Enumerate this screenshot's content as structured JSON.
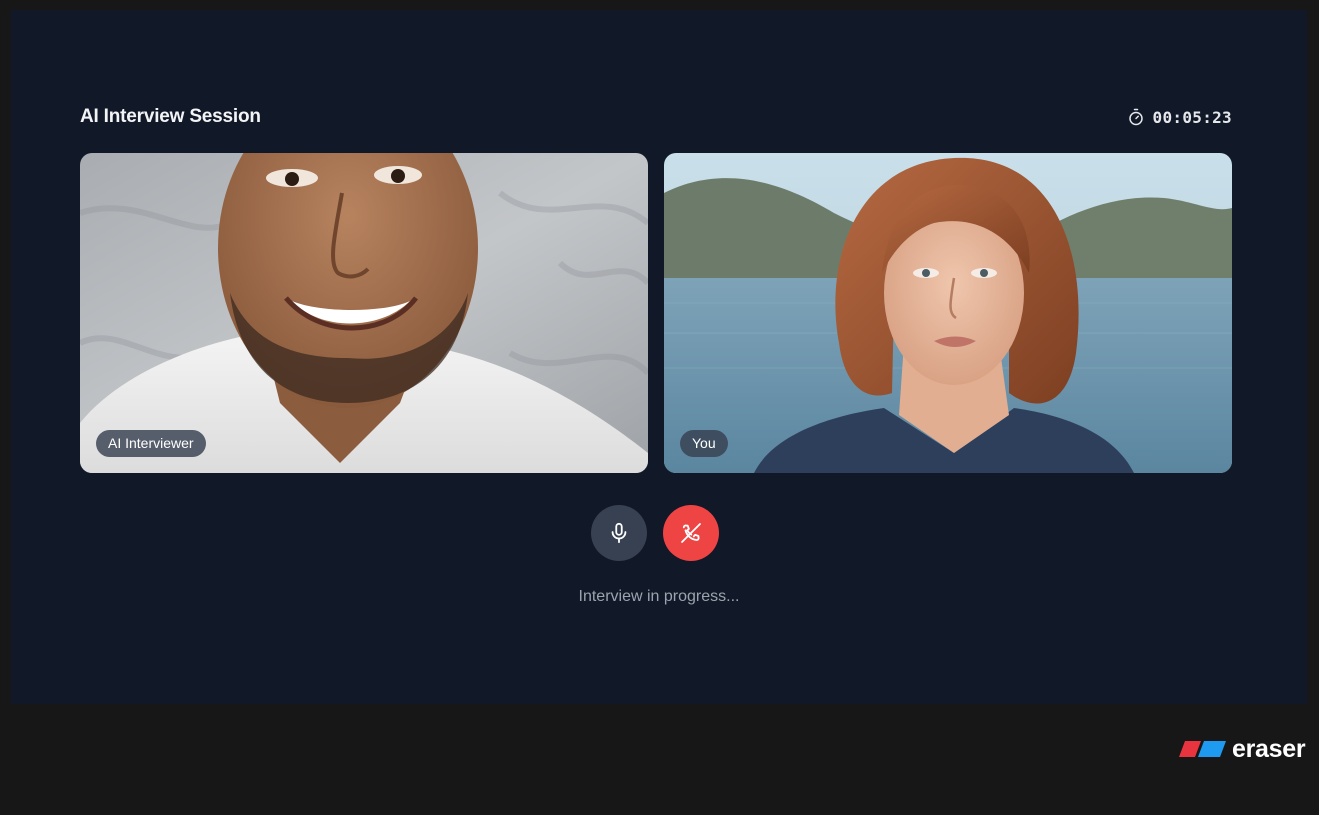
{
  "session": {
    "title": "AI Interview Session",
    "timer": "00:05:23",
    "timer_icon": "stopwatch-icon"
  },
  "participants": [
    {
      "label": "AI Interviewer"
    },
    {
      "label": "You"
    }
  ],
  "controls": {
    "mic_icon": "microphone-icon",
    "end_call_icon": "phone-off-icon"
  },
  "status": "Interview in progress...",
  "branding": {
    "name": "eraser",
    "logo_icon": "eraser-logo",
    "colors": {
      "red": "#e8343f",
      "blue": "#1e9bf0"
    }
  },
  "colors": {
    "background": "#111827",
    "end_call": "#ef4444",
    "mic_button": "#374151"
  }
}
